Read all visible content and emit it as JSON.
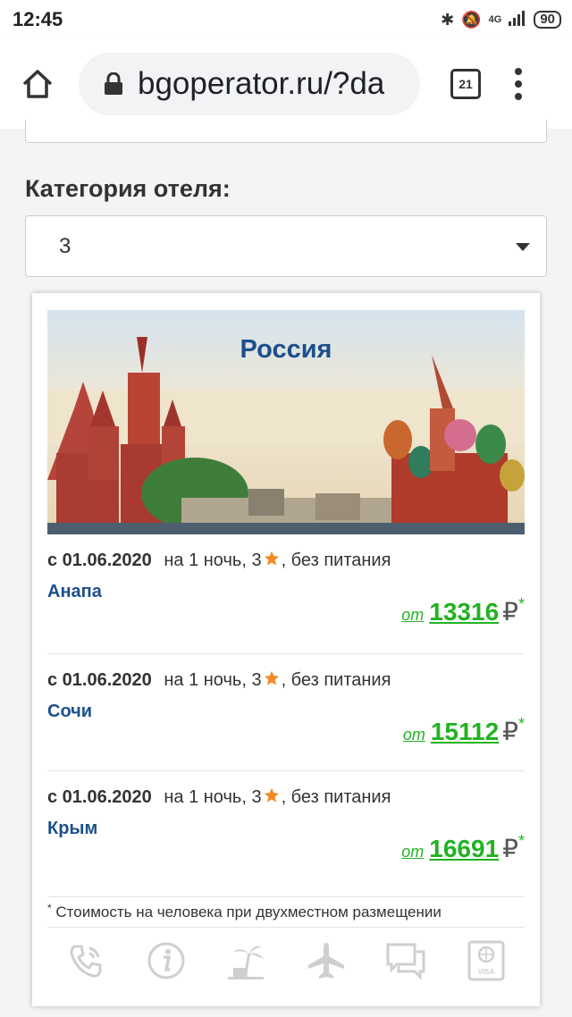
{
  "status_bar": {
    "time": "12:45",
    "network": "4G",
    "battery": "90"
  },
  "browser": {
    "url": "bgoperator.ru/?da",
    "tab_count": "21"
  },
  "filter": {
    "label": "Категория отеля:",
    "selected": "3"
  },
  "card": {
    "title": "Россия",
    "offers": [
      {
        "date": "с 01.06.2020",
        "nights": "на 1 ночь,",
        "stars": "3",
        "meal": ", без питания",
        "city": "Анапа",
        "from": "от",
        "price": "13316",
        "currency": "₽",
        "mark": "*"
      },
      {
        "date": "с 01.06.2020",
        "nights": "на 1 ночь,",
        "stars": "3",
        "meal": ", без питания",
        "city": "Сочи",
        "from": "от",
        "price": "15112",
        "currency": "₽",
        "mark": "*"
      },
      {
        "date": "с 01.06.2020",
        "nights": "на 1 ночь,",
        "stars": "3",
        "meal": ", без питания",
        "city": "Крым",
        "from": "от",
        "price": "16691",
        "currency": "₽",
        "mark": "*"
      }
    ],
    "footnote_mark": "*",
    "footnote": "Стоимость на человека при двухместном размещении",
    "icon_badge": "VISA"
  },
  "colors": {
    "accent_blue": "#1c4f8c",
    "price_green": "#22b222",
    "star_orange": "#f08a24"
  },
  "icons": [
    "home-icon",
    "lock-icon",
    "tabs-icon",
    "menu-icon",
    "phone-icon",
    "info-icon",
    "palm-icon",
    "plane-icon",
    "chat-icon",
    "visa-icon"
  ]
}
